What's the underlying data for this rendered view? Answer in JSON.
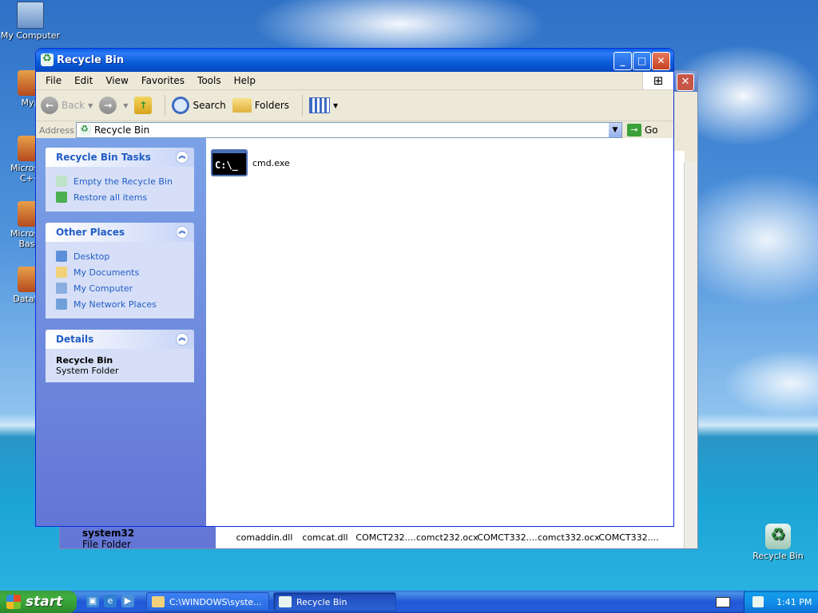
{
  "desktop": {
    "icons": [
      {
        "label": "My Computer"
      },
      {
        "label": "Myp"
      },
      {
        "label": "Microsoft C++"
      },
      {
        "label": "Microsoft Basic"
      },
      {
        "label": "DataWa"
      },
      {
        "label": "Recycle Bin"
      }
    ]
  },
  "background_window": {
    "left_item_name": "system32",
    "left_item_type": "File Folder",
    "files": [
      "comaddin.dll",
      "comcat.dll",
      "COMCT232....",
      "comct232.ocx",
      "COMCT332....",
      "comct332.ocx",
      "COMCT332...."
    ],
    "close_glyph": "✕"
  },
  "window": {
    "title": "Recycle Bin",
    "buttons": {
      "minimize": "_",
      "maximize": "□",
      "close": "✕"
    },
    "menu": [
      "File",
      "Edit",
      "View",
      "Favorites",
      "Tools",
      "Help"
    ],
    "toolbar": {
      "back": "Back",
      "search": "Search",
      "folders": "Folders"
    },
    "address": {
      "label": "Address",
      "value": "Recycle Bin",
      "go": "Go"
    },
    "tasks_panel": {
      "title": "Recycle Bin Tasks",
      "links": [
        "Empty the Recycle Bin",
        "Restore all items"
      ]
    },
    "places_panel": {
      "title": "Other Places",
      "links": [
        "Desktop",
        "My Documents",
        "My Computer",
        "My Network Places"
      ]
    },
    "details_panel": {
      "title": "Details",
      "name": "Recycle Bin",
      "type": "System Folder"
    },
    "files": [
      {
        "name": "cmd.exe",
        "icon_text": "C:\\_"
      }
    ]
  },
  "taskbar": {
    "start": "start",
    "items": [
      {
        "label": "C:\\WINDOWS\\syste..."
      },
      {
        "label": "Recycle Bin"
      }
    ],
    "clock": "1:41 PM"
  }
}
